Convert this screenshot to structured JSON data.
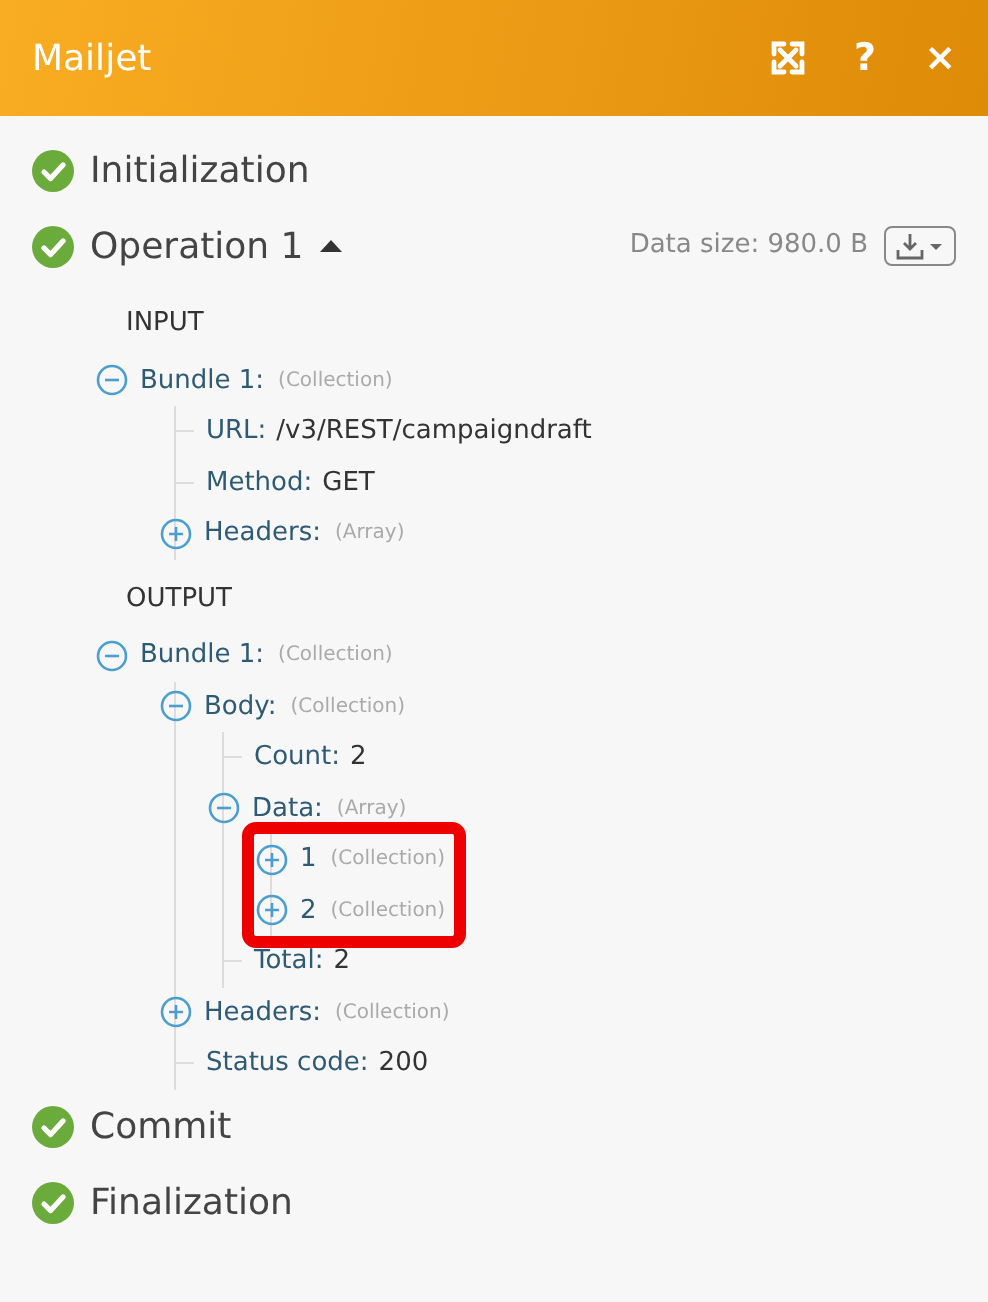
{
  "header": {
    "title": "Mailjet",
    "actions": [
      {
        "kind": "expand"
      },
      {
        "kind": "help",
        "label": "?"
      },
      {
        "kind": "close",
        "label": "×"
      }
    ]
  },
  "steps": [
    {
      "label": "Initialization",
      "completed": true
    },
    {
      "label": "Operation 1",
      "completed": true,
      "expanded": true,
      "data_size": "Data size: 980.0 B",
      "sections": [
        {
          "title": "INPUT",
          "nodes": [
            {
              "label": "Bundle 1:",
              "type": "(Collection)",
              "expanded": true,
              "children": [
                {
                  "label": "URL:",
                  "value": "/v3/REST/campaigndraft"
                },
                {
                  "label": "Method:",
                  "value": "GET"
                },
                {
                  "label": "Headers:",
                  "type": "(Array)",
                  "expanded": false
                }
              ]
            }
          ]
        },
        {
          "title": "OUTPUT",
          "nodes": [
            {
              "label": "Bundle 1:",
              "type": "(Collection)",
              "expanded": true,
              "children": [
                {
                  "label": "Body:",
                  "type": "(Collection)",
                  "expanded": true,
                  "children": [
                    {
                      "label": "Count:",
                      "value": "2"
                    },
                    {
                      "label": "Data:",
                      "type": "(Array)",
                      "expanded": true,
                      "children": [
                        {
                          "label": "1",
                          "type": "(Collection)",
                          "expanded": false,
                          "highlighted": true
                        },
                        {
                          "label": "2",
                          "type": "(Collection)",
                          "expanded": false,
                          "highlighted": true
                        }
                      ]
                    },
                    {
                      "label": "Total:",
                      "value": "2"
                    }
                  ]
                },
                {
                  "label": "Headers:",
                  "type": "(Collection)",
                  "expanded": false
                },
                {
                  "label": "Status code:",
                  "value": "200"
                }
              ]
            }
          ]
        }
      ]
    },
    {
      "label": "Commit",
      "completed": true
    },
    {
      "label": "Finalization",
      "completed": true
    }
  ]
}
